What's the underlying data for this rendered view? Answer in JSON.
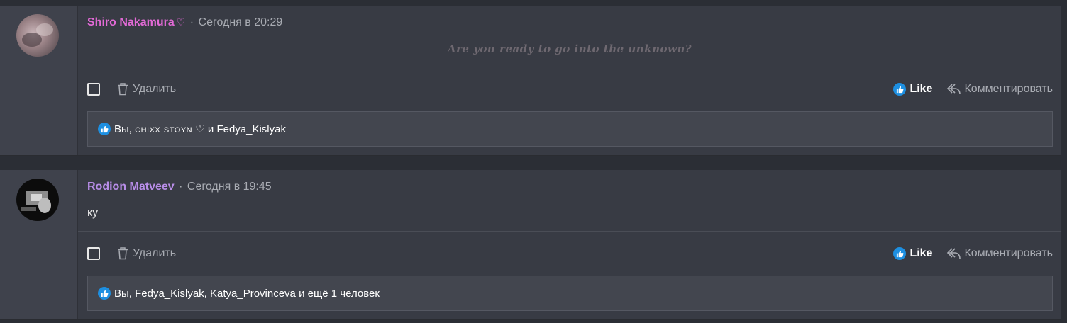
{
  "posts": [
    {
      "author": "Shiro Nakamura",
      "author_suffix": "♡",
      "separator": "·",
      "timestamp": "Сегодня в 20:29",
      "text": "Are you ready to go into the unknown?",
      "delete_label": "Удалить",
      "like_label": "Like",
      "comment_label": "Комментировать",
      "likes_prefix": "Вы, ",
      "likes_smallcaps": "chixx stoyn",
      "likes_suffix": " ♡ и Fedya_Kislyak"
    },
    {
      "author": "Rodion Matveev",
      "separator": "·",
      "timestamp": "Сегодня в 19:45",
      "text": "ку",
      "delete_label": "Удалить",
      "like_label": "Like",
      "comment_label": "Комментировать",
      "likes_text": "Вы, Fedya_Kislyak, Katya_Provinceva и ещё 1 человек"
    }
  ],
  "colors": {
    "author_pink": "#e36ad7",
    "author_purple": "#b88de8",
    "like_blue": "#1d8fe1",
    "background": "#2b2e35",
    "card": "#383b44"
  },
  "icons": [
    "trash-icon",
    "thumbs-up-icon",
    "reply-icon",
    "checkbox"
  ]
}
